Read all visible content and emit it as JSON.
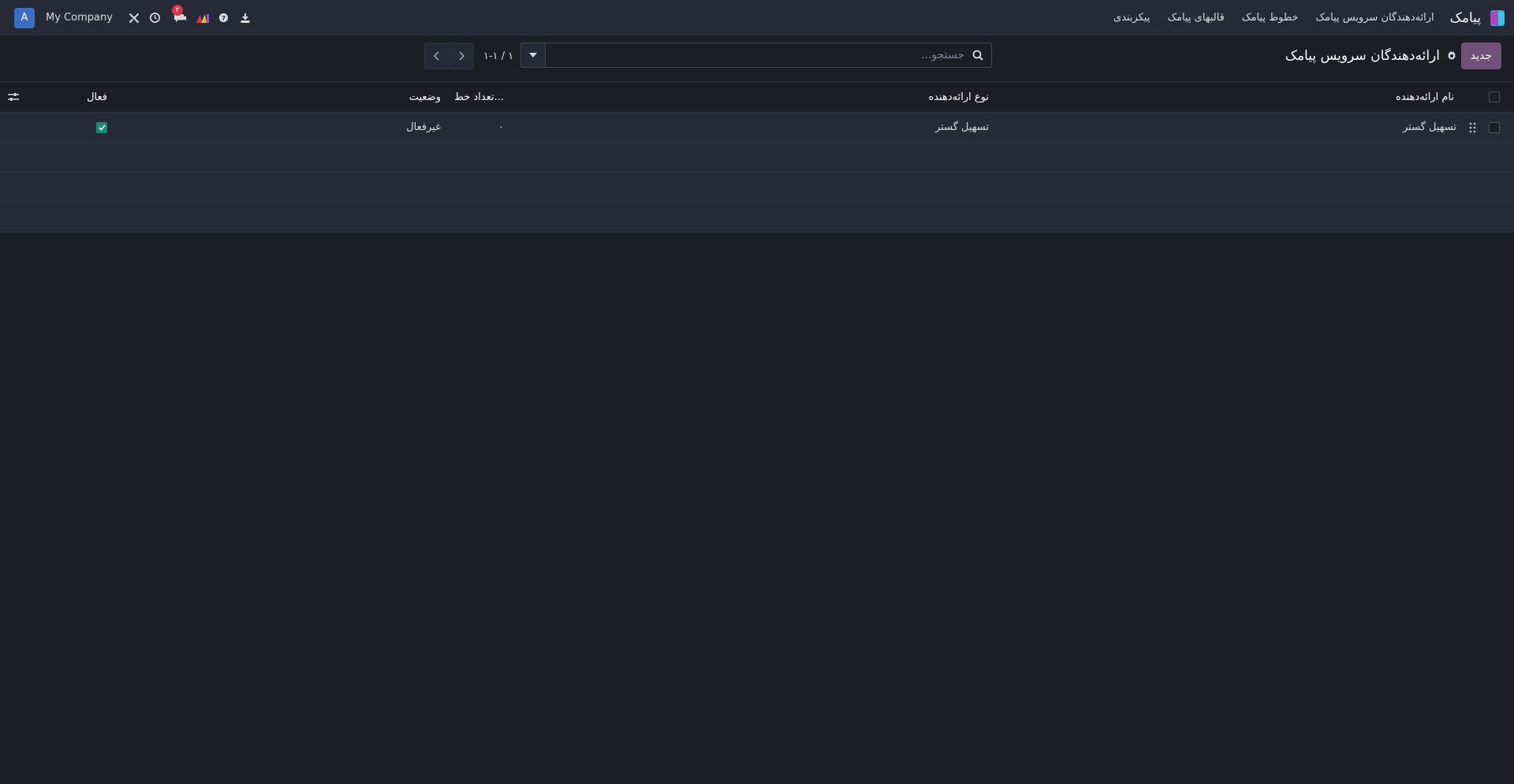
{
  "navbar": {
    "app_name": "پیامک",
    "menu": [
      "ارائه‌دهندگان سرویس پیامک",
      "خطوط پیامک",
      "قالبهای پیامک",
      "پیکربندی"
    ],
    "company": "My Company",
    "avatar_letter": "A",
    "chat_badge": "۲",
    "icons": [
      "download-icon",
      "help-icon",
      "activity-logo-icon",
      "chat-icon",
      "clock-icon",
      "tools-icon"
    ]
  },
  "control_panel": {
    "new_label": "جدید",
    "breadcrumb": "ارائه‌دهندگان سرویس پیامک",
    "search_placeholder": "جستجو...",
    "pager_value": "۱-۱ / ۱"
  },
  "table": {
    "headers": {
      "name": "نام ارائه‌دهنده",
      "type": "نوع ارائه‌دهنده",
      "line_count": "تعداد خط...",
      "status": "وضعیت",
      "active": "فعال"
    },
    "rows": [
      {
        "name": "تسهیل گستر",
        "type": "تسهیل گستر",
        "line_count": "۰",
        "status": "غیرفعال",
        "active": true
      }
    ]
  },
  "colors": {
    "background": "#1c1e26",
    "navbar": "#262a36",
    "primary_button": "#71507a",
    "checkbox_active": "#1a8a7a",
    "badge": "#d6354a",
    "avatar": "#3b6ec2"
  }
}
